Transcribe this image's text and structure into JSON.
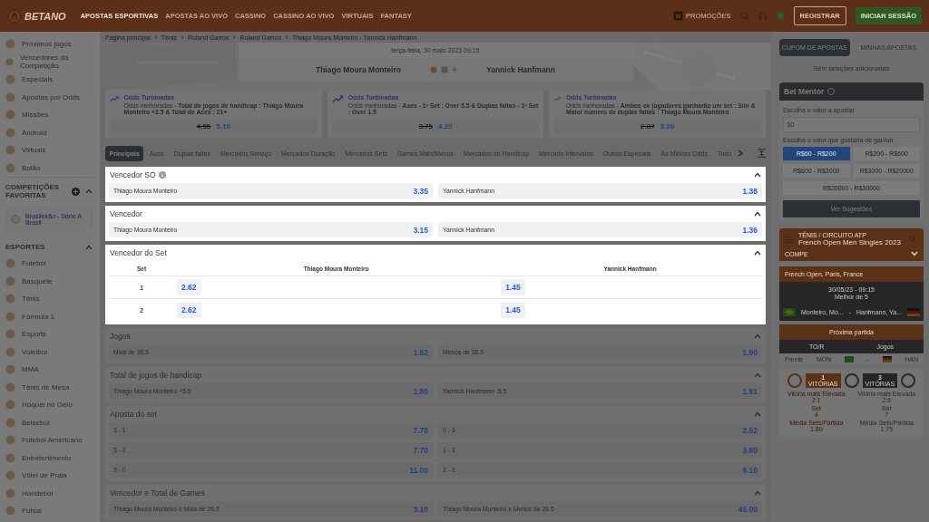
{
  "topbar": {
    "logo": "BETANO",
    "nav": [
      {
        "label": "APOSTAS ESPORTIVAS",
        "selected": true
      },
      {
        "label": "APOSTAS AO VIVO",
        "selected": false
      },
      {
        "label": "CASSINO",
        "selected": false
      },
      {
        "label": "CASSINO AO VIVO",
        "selected": false
      },
      {
        "label": "VIRTUAIS",
        "selected": false
      },
      {
        "label": "FANTASY",
        "selected": false
      }
    ],
    "promotions": "PROMOÇÕES",
    "register": "REGISTRAR",
    "login": "INICIAR SESSÃO"
  },
  "sidebar": {
    "items": [
      "Próximos jogos",
      "Vencedores da Competição",
      "Especiais",
      "Apostas por Odds",
      "Missões",
      "Android",
      "Virtuais",
      "Bolão"
    ],
    "favorites": {
      "title": "COMPETIÇÕES FAVORITAS",
      "expanded": true,
      "items": [
        {
          "name": "Brasileirão - Série A",
          "country": "Brasil"
        }
      ]
    },
    "sports": {
      "title": "ESPORTES",
      "expanded": true,
      "items": [
        "Futebol",
        "Basquete",
        "Tênis",
        "Fórmula 1",
        "Esports",
        "Voleibol",
        "MMA",
        "Tênis de Mesa",
        "Hóquei no Gelo",
        "Beisebol",
        "Futebol Americano",
        "Entretenimento",
        "Vôlei de Praia",
        "Handebol",
        "Futsal"
      ]
    }
  },
  "breadcrumb": [
    "Página principal",
    "Tênis",
    "Roland Garros",
    "Roland Garros",
    "Thiago Moura Monteiro - Yannick Hanfmann"
  ],
  "event": {
    "datetime": "terça-feira, 30 maio 2023 09:15",
    "home": "Thiago Moura Monteiro",
    "away": "Yannick Hanfmann"
  },
  "boosts": [
    {
      "title": "Odds Turbinadas",
      "description": "Odds melhoradas - **Total de jogos de handicap : Thiago Moura Monteiro +3.5 & Total de Aces : 21+**",
      "old_odds": "4.55",
      "odds": "5.10"
    },
    {
      "title": "Odds Turbinadas",
      "description": "Odds melhoradas - **Ases - 1º Set : Over 5.5 & Duplas faltas - 1º Set : Over 1.5**",
      "old_odds": "3.75",
      "odds": "4.20"
    },
    {
      "title": "Odds Turbinadas",
      "description": "Odds melhoradas - **Ambos os jogadores ganharão um set : Sim & Maior número de duplas faltas : Thiago Moura Monteiro**",
      "old_odds": "2.87",
      "odds": "3.20"
    }
  ],
  "market_tabs": [
    {
      "label": "Principais",
      "selected": true
    },
    {
      "label": "Aces",
      "selected": false
    },
    {
      "label": "Duplas faltas",
      "selected": false
    },
    {
      "label": "Mercados Serviço",
      "selected": false
    },
    {
      "label": "Mercados Duração",
      "selected": false
    },
    {
      "label": "Mercados Sets",
      "selected": false
    },
    {
      "label": "Games Mais/Menos",
      "selected": false
    },
    {
      "label": "Mercados de Handicap",
      "selected": false
    },
    {
      "label": "Mercado Intervalos",
      "selected": false
    },
    {
      "label": "Outros Especiais",
      "selected": false
    },
    {
      "label": "As Minhas Odds",
      "selected": false
    },
    {
      "label": "Todo",
      "selected": false
    }
  ],
  "markets": [
    {
      "kind": "pair",
      "title": "Vencedor SO",
      "info": true,
      "highlighted": true,
      "expanded": true,
      "rows": [
        [
          {
            "label": "Thiago Moura Monteiro",
            "odds": "3.35"
          },
          {
            "label": "Yannick Hanfmann",
            "odds": "1.38"
          }
        ]
      ]
    },
    {
      "kind": "pair",
      "title": "Vencedor",
      "highlighted": true,
      "expanded": true,
      "rows": [
        [
          {
            "label": "Thiago Moura Monteiro",
            "odds": "3.15"
          },
          {
            "label": "Yannick Hanfmann",
            "odds": "1.36"
          }
        ]
      ]
    },
    {
      "kind": "table",
      "title": "Vencedor do Set",
      "highlighted": true,
      "expanded": true,
      "columns": [
        "Set",
        "Thiago Moura Monteiro",
        "Yannick Hanfmann"
      ],
      "rows": [
        {
          "set": "1",
          "odds": [
            "2.62",
            "1.45"
          ]
        },
        {
          "set": "2",
          "odds": [
            "2.62",
            "1.45"
          ]
        }
      ]
    },
    {
      "kind": "pair",
      "title": "Jogos",
      "highlighted": false,
      "expanded": true,
      "rows": [
        [
          {
            "label": "Mais de 36.5",
            "odds": "1.82"
          },
          {
            "label": "Menos de 36.5",
            "odds": "1.90"
          }
        ]
      ]
    },
    {
      "kind": "pair",
      "title": "Total de jogos de handicap",
      "highlighted": false,
      "expanded": true,
      "rows": [
        [
          {
            "label": "Thiago Moura Monteiro +5.5",
            "odds": "1.80"
          },
          {
            "label": "Yannick Hanfmann -5.5",
            "odds": "1.91"
          }
        ]
      ]
    },
    {
      "kind": "pair",
      "title": "Aposta do set",
      "highlighted": false,
      "expanded": true,
      "rows": [
        [
          {
            "label": "3 - 1",
            "odds": "7.70"
          },
          {
            "label": "0 - 3",
            "odds": "2.52"
          }
        ],
        [
          {
            "label": "3 - 2",
            "odds": "7.70"
          },
          {
            "label": "1 - 3",
            "odds": "3.80"
          }
        ],
        [
          {
            "label": "3 - 0",
            "odds": "11.00"
          },
          {
            "label": "2 - 3",
            "odds": "6.10"
          }
        ]
      ]
    },
    {
      "kind": "pair",
      "title": "Vencedor e Total de Games",
      "highlighted": false,
      "expanded": true,
      "rows": [
        [
          {
            "label": "Thiago Moura Monteiro e Mais de 26.5",
            "odds": "3.10"
          },
          {
            "label": "Thiago Moura Monteiro e Menos de 26.5",
            "odds": "45.00"
          }
        ]
      ]
    }
  ],
  "betslip": {
    "tabs": [
      {
        "label": "CUPOM DE APOSTAS",
        "selected": true
      },
      {
        "label": "MINHAS APOSTAS",
        "selected": false
      }
    ],
    "empty": "Sem seleções adicionadas",
    "mentor": {
      "title": "Bet Mentor",
      "stake_label": "Escolha o valor a apostar",
      "stake": "30",
      "win_label": "Escolha o valor que gostaria de ganhar",
      "ranges": [
        {
          "label": "R$60 - R$200",
          "selected": true
        },
        {
          "label": "R$200 - R$600",
          "selected": false
        },
        {
          "label": "R$600 - R$3000",
          "selected": false
        },
        {
          "label": "R$3000 - R$20000",
          "selected": false
        },
        {
          "label": "R$20000 - R$30000",
          "selected": false
        }
      ],
      "button": "Ver Sugestões"
    },
    "widget": {
      "category": "TÊNIS / CIRCUITO ATP",
      "competition": "French Open Men Singles 2023",
      "filter": "COMPE",
      "venue": "French Open, Paris, France",
      "date": "30/05/23 - 09:15",
      "format": "Melhor de 5",
      "home": "Monteiro, Mo...",
      "separator": "-",
      "away": "Hanfmann, Ya...",
      "next_title": "Próxima partida",
      "col_1": "TO/R",
      "col_2": "Jogos",
      "row_label": "Frente",
      "home_code": "MON",
      "dash": "-",
      "away_code": "HAN",
      "wins": [
        {
          "count": "1",
          "label": "VITÓRIAS"
        },
        {
          "count": "3",
          "label": "VITÓRIAS"
        }
      ],
      "stats": [
        {
          "home_label": "Vitória mais Elevada",
          "home": "2:1",
          "away_label": "Vitória mais Elevada",
          "away": "2:6"
        },
        {
          "home_label": "Set",
          "home": "4",
          "away_label": "Set",
          "away": "7"
        },
        {
          "home_label": "Média Sets/Partida",
          "home": "1.80",
          "away_label": "Média Sets/Partida",
          "away": "1.75"
        }
      ]
    }
  }
}
